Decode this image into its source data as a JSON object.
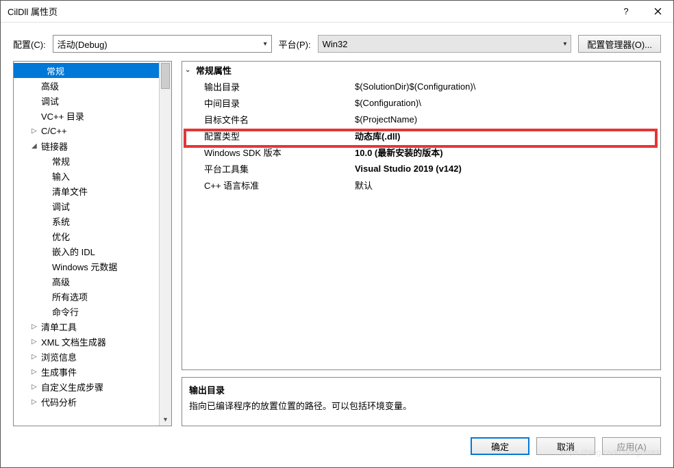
{
  "titlebar": {
    "title": "CilDll 属性页"
  },
  "topbar": {
    "config_label": "配置(C):",
    "config_value": "活动(Debug)",
    "platform_label": "平台(P):",
    "platform_value": "Win32",
    "manager_btn": "配置管理器(O)..."
  },
  "tree": [
    {
      "label": "常规",
      "indent": 1,
      "selected": true
    },
    {
      "label": "高级",
      "indent": 1
    },
    {
      "label": "调试",
      "indent": 1
    },
    {
      "label": "VC++ 目录",
      "indent": 1
    },
    {
      "label": "C/C++",
      "indent": 1,
      "expander": "▷"
    },
    {
      "label": "链接器",
      "indent": 1,
      "expander": "◢"
    },
    {
      "label": "常规",
      "indent": 2
    },
    {
      "label": "输入",
      "indent": 2
    },
    {
      "label": "清单文件",
      "indent": 2
    },
    {
      "label": "调试",
      "indent": 2
    },
    {
      "label": "系统",
      "indent": 2
    },
    {
      "label": "优化",
      "indent": 2
    },
    {
      "label": "嵌入的 IDL",
      "indent": 2
    },
    {
      "label": "Windows 元数据",
      "indent": 2
    },
    {
      "label": "高级",
      "indent": 2
    },
    {
      "label": "所有选项",
      "indent": 2
    },
    {
      "label": "命令行",
      "indent": 2
    },
    {
      "label": "清单工具",
      "indent": 1,
      "expander": "▷"
    },
    {
      "label": "XML 文档生成器",
      "indent": 1,
      "expander": "▷"
    },
    {
      "label": "浏览信息",
      "indent": 1,
      "expander": "▷"
    },
    {
      "label": "生成事件",
      "indent": 1,
      "expander": "▷"
    },
    {
      "label": "自定义生成步骤",
      "indent": 1,
      "expander": "▷"
    },
    {
      "label": "代码分析",
      "indent": 1,
      "expander": "▷"
    }
  ],
  "group_title": "常规属性",
  "props": [
    {
      "name": "输出目录",
      "value": "$(SolutionDir)$(Configuration)\\"
    },
    {
      "name": "中间目录",
      "value": "$(Configuration)\\"
    },
    {
      "name": "目标文件名",
      "value": "$(ProjectName)"
    },
    {
      "name": "配置类型",
      "value": "动态库(.dll)",
      "bold": true,
      "highlight": true
    },
    {
      "name": "Windows SDK 版本",
      "value": "10.0 (最新安装的版本)",
      "bold": true
    },
    {
      "name": "平台工具集",
      "value": "Visual Studio 2019 (v142)",
      "bold": true
    },
    {
      "name": "C++ 语言标准",
      "value": "默认"
    }
  ],
  "desc": {
    "title": "输出目录",
    "text": "指向已编译程序的放置位置的路径。可以包括环境变量。"
  },
  "footer": {
    "ok": "确定",
    "cancel": "取消",
    "apply": "应用(A)"
  },
  "watermark": "https://blog.csdn.net/yumkk"
}
